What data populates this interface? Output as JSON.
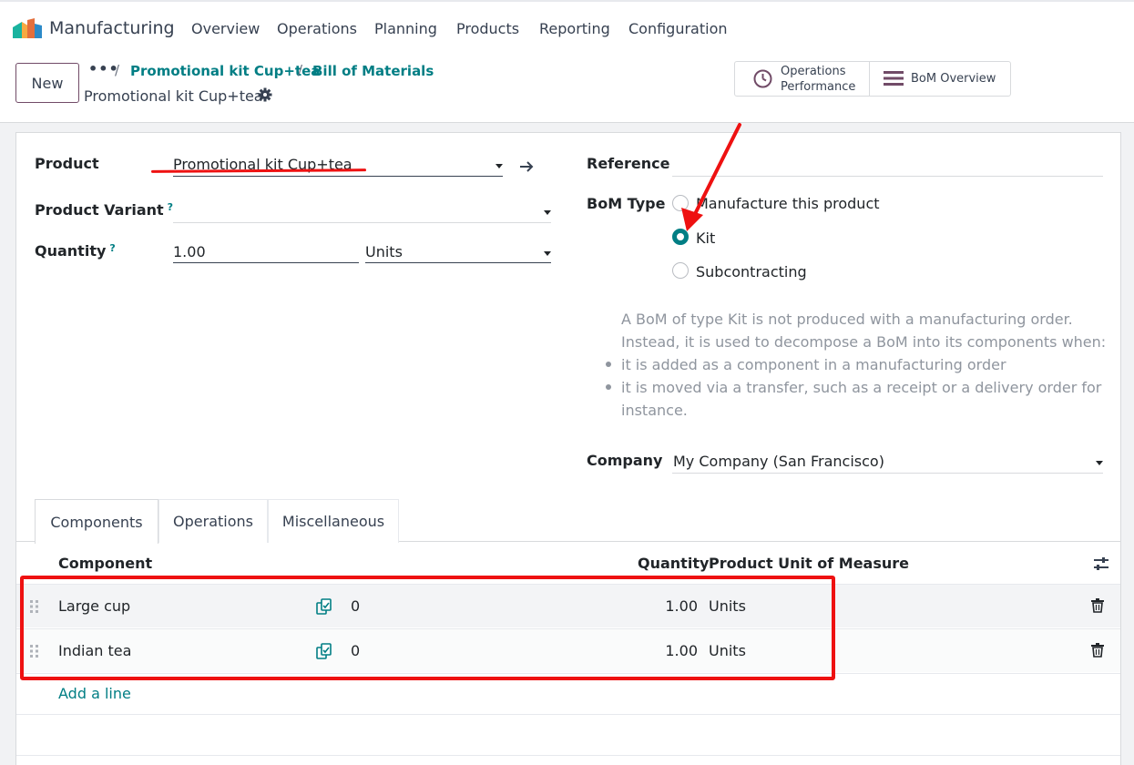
{
  "app": {
    "name": "Manufacturing"
  },
  "menu": [
    "Overview",
    "Operations",
    "Planning",
    "Products",
    "Reporting",
    "Configuration"
  ],
  "control": {
    "new_label": "New",
    "breadcrumb_dots": "•••",
    "breadcrumbs": [
      "Promotional kit Cup+tea",
      "Bill of Materials"
    ],
    "record_title": "Promotional kit Cup+tea",
    "stat_buttons": {
      "ops_perf_line1": "Operations",
      "ops_perf_line2": "Performance",
      "bom_overview": "BoM Overview"
    }
  },
  "form": {
    "product_label": "Product",
    "product_value": "Promotional kit Cup+tea",
    "variant_label": "Product Variant",
    "variant_value": "",
    "quantity_label": "Quantity",
    "quantity_value": "1.00",
    "uom_value": "Units",
    "help_mark": "?",
    "reference_label": "Reference",
    "reference_value": "",
    "bom_type_label": "BoM Type",
    "bom_types": [
      "Manufacture this product",
      "Kit",
      "Subcontracting"
    ],
    "bom_type_selected": "Kit",
    "kit_help": {
      "line1": "A BoM of type Kit is not produced with a manufacturing order.",
      "line2": "Instead, it is used to decompose a BoM into its components when:",
      "bullet1": "it is added as a component in a manufacturing order",
      "bullet2a": "it is moved via a transfer, such as a receipt or a delivery order for",
      "bullet2b": "instance."
    },
    "company_label": "Company",
    "company_value": "My Company (San Francisco)"
  },
  "tabs": [
    "Components",
    "Operations",
    "Miscellaneous"
  ],
  "active_tab": "Components",
  "table": {
    "headers": {
      "component": "Component",
      "quantity": "Quantity",
      "uom": "Product Unit of Measure"
    },
    "rows": [
      {
        "component": "Large cup",
        "forecast": "0",
        "quantity": "1.00",
        "uom": "Units"
      },
      {
        "component": "Indian tea",
        "forecast": "0",
        "quantity": "1.00",
        "uom": "Units"
      }
    ],
    "add_line": "Add a line"
  },
  "colors": {
    "accent": "#017e84",
    "brand": "#714b67",
    "annotation": "#ee1111"
  }
}
